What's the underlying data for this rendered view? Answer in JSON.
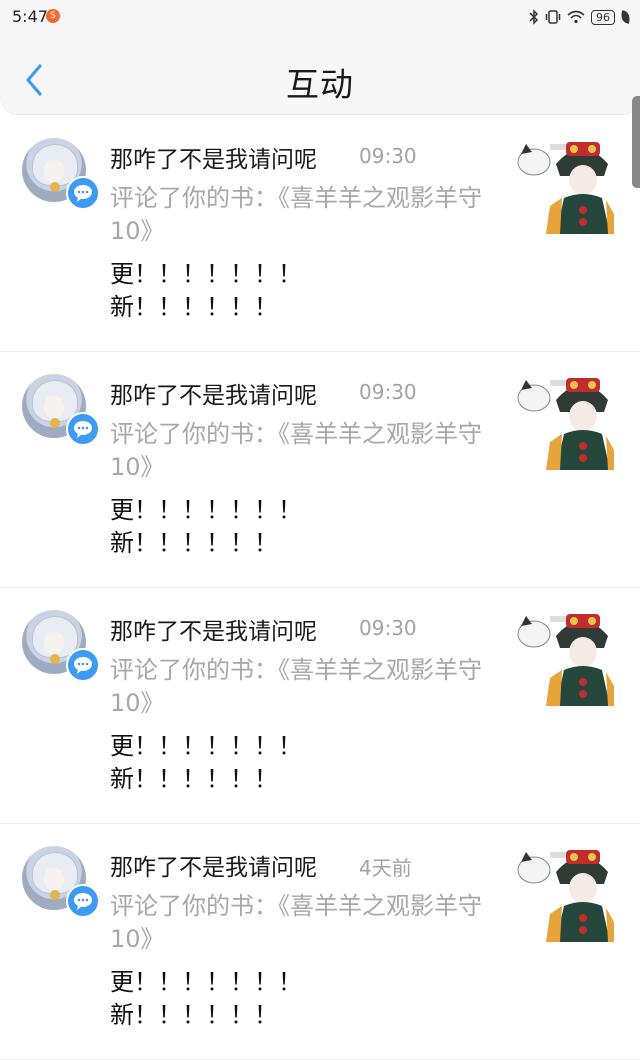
{
  "status_bar": {
    "time": "5:47",
    "app_badge": "S",
    "battery": "96"
  },
  "header": {
    "title": "互动"
  },
  "notifications": [
    {
      "user_name": "那咋了不是我请问呢",
      "time": "09:30",
      "action": "评论了你的书：《喜羊羊之观影羊守10》",
      "comment": "更！！！！！！！\n新！！！！！！"
    },
    {
      "user_name": "那咋了不是我请问呢",
      "time": "09:30",
      "action": "评论了你的书：《喜羊羊之观影羊守10》",
      "comment": "更！！！！！！！\n新！！！！！！"
    },
    {
      "user_name": "那咋了不是我请问呢",
      "time": "09:30",
      "action": "评论了你的书：《喜羊羊之观影羊守10》",
      "comment": "更！！！！！！！\n新！！！！！！"
    },
    {
      "user_name": "那咋了不是我请问呢",
      "time": "4天前",
      "action": "评论了你的书：《喜羊羊之观影羊守10》",
      "comment": "更！！！！！！！\n新！！！！！！"
    }
  ],
  "icons": {
    "back": "chevron-left-icon",
    "comment_badge": "comment-bubble-icon",
    "bluetooth": "bluetooth-icon",
    "vibrate": "vibrate-icon",
    "wifi": "wifi-icon",
    "battery": "battery-icon",
    "leaf": "leaf-icon"
  },
  "colors": {
    "accent": "#3d9bf3",
    "secondary_text": "#a8a8a8",
    "header_bg": "#f7f7f7"
  }
}
